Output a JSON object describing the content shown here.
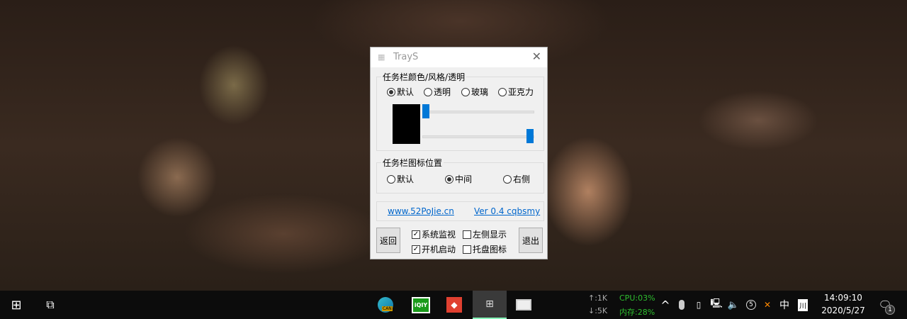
{
  "window": {
    "title": "TrayS",
    "close": "✕"
  },
  "group_color": {
    "legend": "任务栏颜色/风格/透明",
    "options": [
      "默认",
      "透明",
      "玻璃",
      "亚克力"
    ],
    "selected": 0,
    "slider1": 0.0,
    "slider2": 1.0
  },
  "group_pos": {
    "legend": "任务栏图标位置",
    "options": [
      "默认",
      "中间",
      "右侧"
    ],
    "selected": 1
  },
  "links": {
    "site": "www.52PoJie.cn",
    "version": "Ver 0.4 cqbsmy"
  },
  "buttons": {
    "back": "返回",
    "exit": "退出"
  },
  "checks": [
    {
      "label": "系统监视",
      "checked": true
    },
    {
      "label": "左侧显示",
      "checked": false
    },
    {
      "label": "开机启动",
      "checked": true
    },
    {
      "label": "托盘图标",
      "checked": false
    }
  ],
  "taskbar": {
    "net_up": "↑:1K",
    "net_down": "↓:5K",
    "cpu": "CPU:03%",
    "mem": "内存:28%",
    "ime": "中",
    "time": "14:09:10",
    "date": "2020/5/27",
    "notif_count": "1",
    "edge_badge": "CAN",
    "iqiyi": "iQIY",
    "colors": {
      "green": "#2fbf2f",
      "accent": "#0078d7"
    }
  }
}
